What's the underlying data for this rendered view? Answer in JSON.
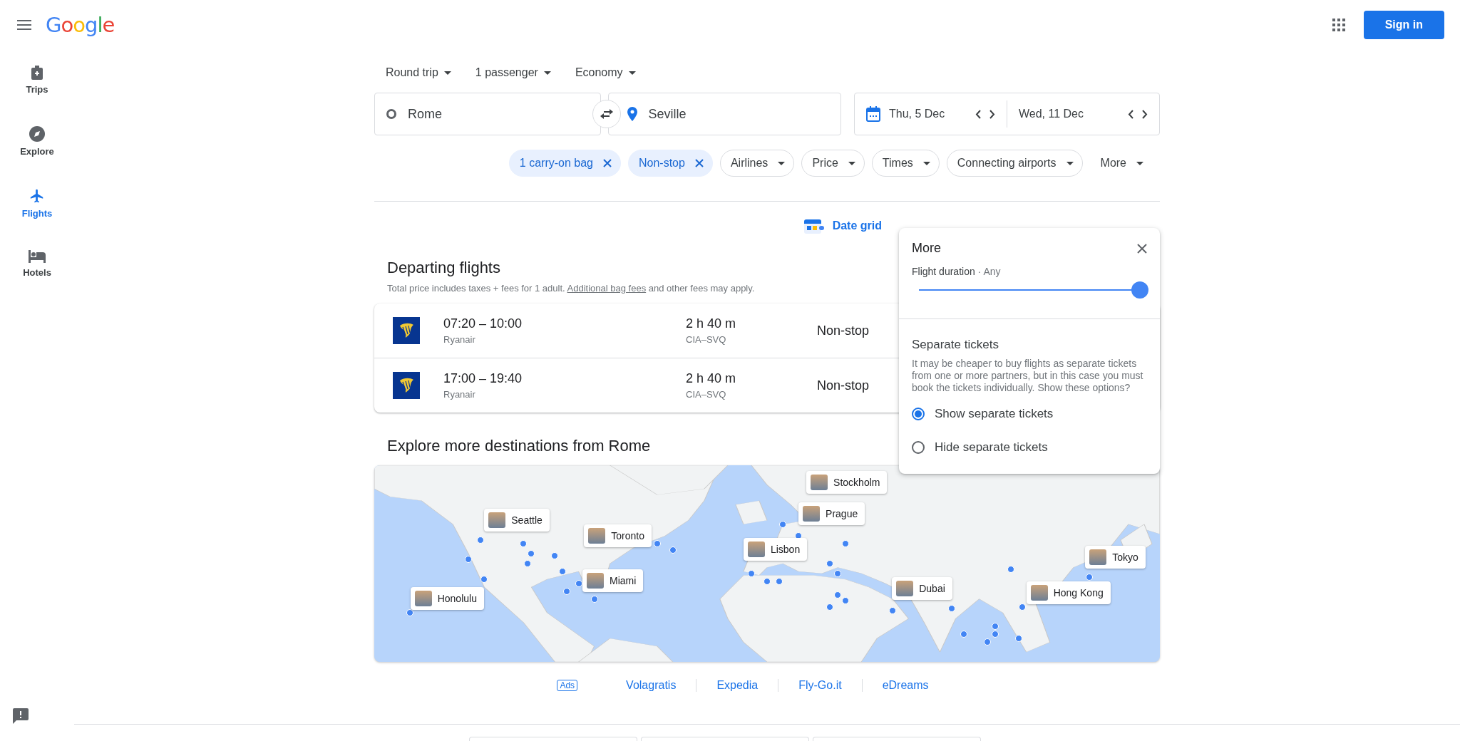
{
  "header": {
    "logo": "Google",
    "sign_in": "Sign in"
  },
  "rail": [
    {
      "label": "Trips",
      "selected": false
    },
    {
      "label": "Explore",
      "selected": false
    },
    {
      "label": "Flights",
      "selected": true
    },
    {
      "label": "Hotels",
      "selected": false
    }
  ],
  "search": {
    "trip_type": "Round trip",
    "passengers": "1 passenger",
    "cabin": "Economy",
    "origin": "Rome",
    "destination": "Seville",
    "depart": "Thu, 5 Dec",
    "return": "Wed, 11 Dec"
  },
  "filters": [
    {
      "label": "1 carry-on bag",
      "kind": "chip",
      "applied": true
    },
    {
      "label": "Non-stop",
      "kind": "chip",
      "applied": true
    },
    {
      "label": "Airlines",
      "kind": "chip",
      "applied": false
    },
    {
      "label": "Price",
      "kind": "chip",
      "applied": false
    },
    {
      "label": "Times",
      "kind": "chip",
      "applied": false
    },
    {
      "label": "Connecting airports",
      "kind": "chip",
      "applied": false
    },
    {
      "label": "More",
      "kind": "menu",
      "applied": false
    }
  ],
  "date_grid": "Date grid",
  "results": {
    "title": "Departing flights",
    "note_before": "Total price includes taxes + fees for 1 adult. ",
    "note_link": "Additional bag fees",
    "note_after": " and other fees may apply.",
    "flights": [
      {
        "times": "07:20 – 10:00",
        "airline": "Ryanair",
        "duration": "2 h 40 m",
        "route": "CIA–SVQ",
        "stops": "Non-stop"
      },
      {
        "times": "17:00 – 19:40",
        "airline": "Ryanair",
        "duration": "2 h 40 m",
        "route": "CIA–SVQ",
        "stops": "Non-stop"
      }
    ]
  },
  "explore": {
    "title": "Explore more destinations from Rome",
    "destinations": [
      {
        "name": "Stockholm"
      },
      {
        "name": "Seattle"
      },
      {
        "name": "Toronto"
      },
      {
        "name": "Prague"
      },
      {
        "name": "Lisbon"
      },
      {
        "name": "Miami"
      },
      {
        "name": "Honolulu"
      },
      {
        "name": "Dubai"
      },
      {
        "name": "Tokyo"
      },
      {
        "name": "Hong Kong"
      }
    ]
  },
  "ads": {
    "badge": "Ads",
    "links": [
      "Volagratis",
      "Expedia",
      "Fly-Go.it",
      "eDreams"
    ]
  },
  "more_panel": {
    "title": "More",
    "duration_label": "Flight duration",
    "duration_value": "· Any",
    "level": 1,
    "separate_title": "Separate tickets",
    "separate_text": "It may be cheaper to buy flights as separate tickets from one or more partners, but in this case you must book the tickets individually. Show these options?",
    "options": [
      {
        "label": "Show separate tickets",
        "selected": true
      },
      {
        "label": "Hide separate tickets",
        "selected": false
      }
    ]
  }
}
